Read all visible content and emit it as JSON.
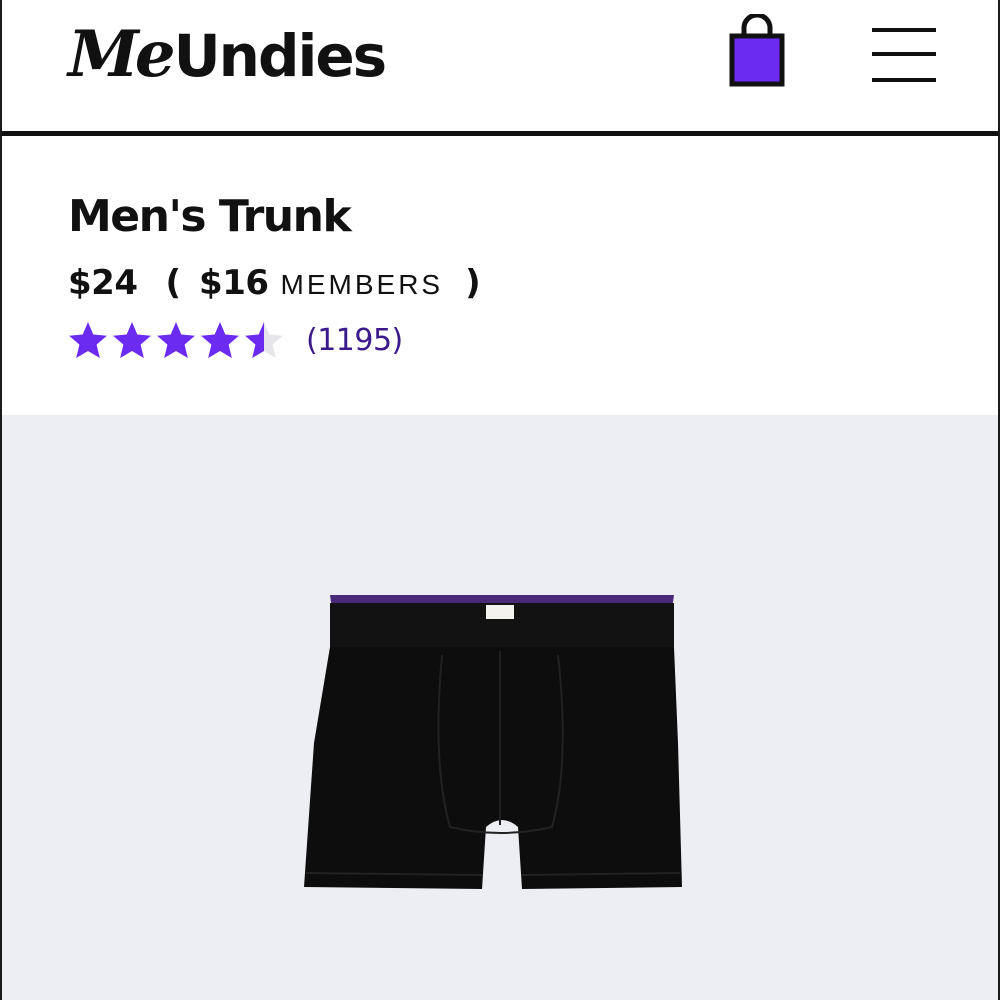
{
  "header": {
    "logo_script": "Me",
    "logo_text": "Undies",
    "cart_icon": "shopping-bag-icon",
    "menu_icon": "hamburger-menu-icon"
  },
  "product": {
    "title": "Men's Trunk",
    "price": "$24",
    "paren_open": "(",
    "member_price": "$16",
    "member_label": "MEMBERS",
    "paren_close": ")",
    "rating": 4.5,
    "rating_max": 5,
    "review_count": "(1195)",
    "image_icon": "trunk-underwear-image"
  },
  "colors": {
    "brand_purple": "#6c2bf0",
    "text": "#111111",
    "image_background": "#eceef2",
    "star_empty": "#e6e6ea"
  }
}
